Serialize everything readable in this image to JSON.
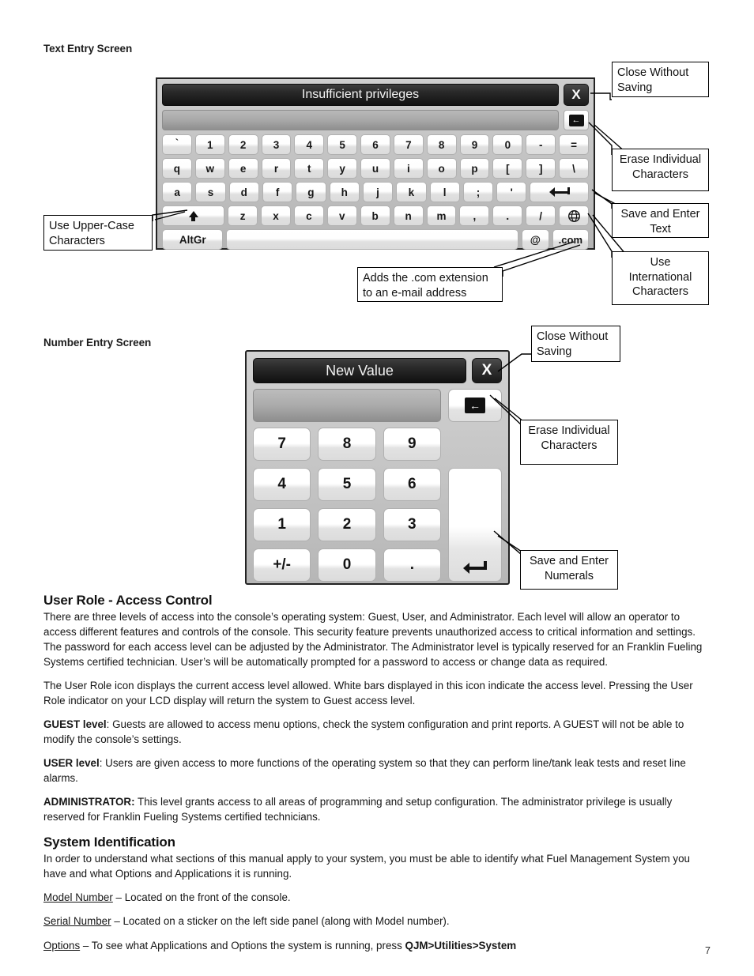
{
  "page": {
    "number": "7"
  },
  "text_entry_section": {
    "label": "Text Entry Screen",
    "keyboard": {
      "title": "Insufficient privileges",
      "input_value": "",
      "close_label": "X",
      "backspace_icon": "backspace-left-arrow-icon",
      "rows": [
        [
          "`",
          "1",
          "2",
          "3",
          "4",
          "5",
          "6",
          "7",
          "8",
          "9",
          "0",
          "-",
          "="
        ],
        [
          "q",
          "w",
          "e",
          "r",
          "t",
          "y",
          "u",
          "i",
          "o",
          "p",
          "[",
          "]",
          "\\"
        ],
        [
          "a",
          "s",
          "d",
          "f",
          "g",
          "h",
          "j",
          "k",
          "l",
          ";",
          "'"
        ],
        [
          "z",
          "x",
          "c",
          "v",
          "b",
          "n",
          "m",
          ",",
          ".",
          "/"
        ]
      ],
      "enter_icon": "enter-return-arrow-icon",
      "shift_icon": "shift-up-arrow-icon",
      "globe_icon": "globe-international-icon",
      "altgr_label": "AltGr",
      "space_label": "",
      "at_label": "@",
      "dotcom_label": ".com"
    },
    "callouts": [
      {
        "id": "close-without-saving",
        "lines": [
          "Close Without",
          "Saving"
        ],
        "align": "left"
      },
      {
        "id": "erase-individual-characters",
        "lines": [
          "Erase Individual",
          "Characters"
        ],
        "align": "center"
      },
      {
        "id": "save-and-enter-text",
        "lines": [
          "Save and Enter",
          "Text"
        ],
        "align": "center"
      },
      {
        "id": "use-international-characters",
        "lines": [
          "Use",
          "International",
          "Characters"
        ],
        "align": "center"
      },
      {
        "id": "use-upper-case-characters",
        "lines": [
          "Use Upper-Case",
          "Characters"
        ],
        "align": "left"
      },
      {
        "id": "adds-dotcom-extension",
        "lines": [
          "Adds the .com extension",
          "to an e-mail address"
        ],
        "align": "left"
      }
    ]
  },
  "number_entry_section": {
    "label": "Number Entry Screen",
    "numpad": {
      "title": "New Value",
      "input_value": "",
      "close_label": "X",
      "backspace_icon": "backspace-left-arrow-icon",
      "keys": [
        "7",
        "8",
        "9",
        "4",
        "5",
        "6",
        "1",
        "2",
        "3",
        "+/-",
        "0",
        "."
      ],
      "enter_icon": "enter-return-arrow-icon"
    },
    "callouts": [
      {
        "id": "close-without-saving",
        "lines": [
          "Close Without",
          "Saving"
        ],
        "align": "left"
      },
      {
        "id": "erase-individual-characters",
        "lines": [
          "Erase Individual",
          "Characters"
        ],
        "align": "center"
      },
      {
        "id": "save-and-enter-numerals",
        "lines": [
          "Save and Enter",
          "Numerals"
        ],
        "align": "center"
      }
    ]
  },
  "user_role": {
    "heading": "User Role - Access Control",
    "paragraph_1": "There are three levels of access into the console’s operating system: Guest, User, and Administrator. Each level will allow an operator to access different features and controls of the console. This security feature prevents unauthorized access to critical information and settings. The password for each access level can be adjusted by the Administrator. The Administrator level is typically reserved for an Franklin Fueling Systems certified technician. User’s will be automatically prompted for a password to access or change data as required.",
    "paragraph_2": "The User Role icon displays the current access level allowed. White bars displayed in this icon indicate the access level. Pressing the User Role indicator on your LCD display will return the system to Guest access level.",
    "guest_label": "GUEST level",
    "guest_text": ": Guests are allowed to access menu options, check the system configuration and print reports. A GUEST will not be able to modify the console’s settings.",
    "user_label": "USER level",
    "user_text": ": Users are given access to more functions of the operating system so that they can perform line/tank leak tests and reset line alarms.",
    "admin_label": "ADMINISTRATOR:",
    "admin_text": " This level grants access to all areas of programming and setup configuration. The administrator privilege is usually reserved for Franklin Fueling Systems certified technicians."
  },
  "system_identification": {
    "heading": "System Identification",
    "paragraph_1": "In order to understand what sections of this manual apply to your system, you must be able to identify what Fuel Management System you have and what Options and Applications it is running.",
    "model_label": "Model Number",
    "model_text": " – Located on the front of the console.",
    "serial_label": "Serial Number",
    "serial_text": " – Located on a sticker on the left side panel (along with Model number).",
    "options_label": "Options",
    "options_text": " – To see what Applications and Options the system is running, press ",
    "options_path": "QJM>Utilities>System"
  }
}
